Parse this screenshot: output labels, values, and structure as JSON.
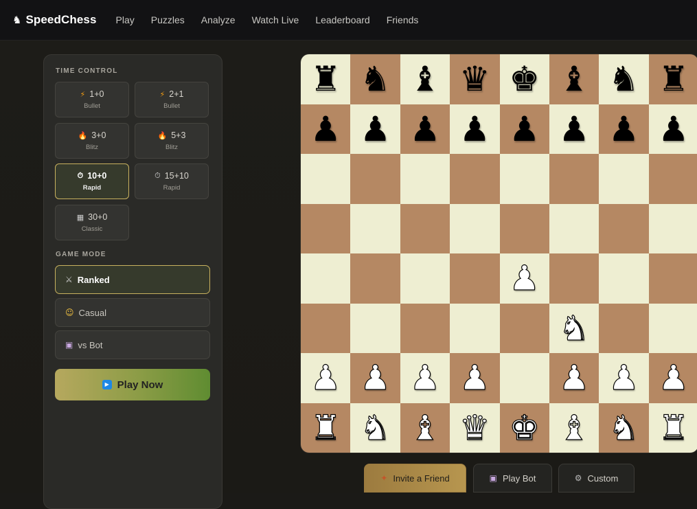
{
  "brand": {
    "icon": "knight-icon",
    "icon_glyph": "♞",
    "name": "SpeedChess"
  },
  "nav": [
    {
      "label": "Play"
    },
    {
      "label": "Puzzles"
    },
    {
      "label": "Analyze"
    },
    {
      "label": "Watch Live"
    },
    {
      "label": "Leaderboard"
    },
    {
      "label": "Friends"
    }
  ],
  "time_control": {
    "title": "TIME CONTROL",
    "options": [
      {
        "icon": "lightning-icon",
        "glyph": "⚡",
        "time": "1+0",
        "type": "Bullet",
        "selected": false
      },
      {
        "icon": "lightning-icon",
        "glyph": "⚡",
        "time": "2+1",
        "type": "Bullet",
        "selected": false
      },
      {
        "icon": "fire-icon",
        "glyph": "🔥",
        "time": "3+0",
        "type": "Blitz",
        "selected": false
      },
      {
        "icon": "fire-icon",
        "glyph": "🔥",
        "time": "5+3",
        "type": "Blitz",
        "selected": false
      },
      {
        "icon": "stopwatch-icon",
        "glyph": "⏱",
        "time": "10+0",
        "type": "Rapid",
        "selected": true
      },
      {
        "icon": "stopwatch-icon",
        "glyph": "⏱",
        "time": "15+10",
        "type": "Rapid",
        "selected": false
      },
      {
        "icon": "chequered-flag-icon",
        "glyph": "▦",
        "time": "30+0",
        "type": "Classic",
        "selected": false
      }
    ]
  },
  "game_mode": {
    "title": "GAME MODE",
    "options": [
      {
        "icon": "crossed-swords-icon",
        "glyph": "⚔",
        "label": "Ranked",
        "selected": true
      },
      {
        "icon": "smiley-icon",
        "glyph": "☺",
        "label": "Casual",
        "selected": false
      },
      {
        "icon": "robot-icon",
        "glyph": "▣",
        "label": "vs Bot",
        "selected": false
      }
    ]
  },
  "play_now": {
    "icon": "play-icon",
    "glyph": "▶",
    "label": "Play Now"
  },
  "board": {
    "light_color": "#eeeed2",
    "dark_color": "#b58863",
    "rows": [
      [
        "br",
        "bn",
        "bb",
        "bq",
        "bk",
        "bb",
        "bn",
        "br"
      ],
      [
        "bp",
        "bp",
        "bp",
        "bp",
        "bp",
        "bp",
        "bp",
        "bp"
      ],
      [
        "",
        "",
        "",
        "",
        "",
        "",
        "",
        ""
      ],
      [
        "",
        "",
        "",
        "",
        "",
        "",
        "",
        ""
      ],
      [
        "",
        "",
        "",
        "",
        "wp",
        "",
        "",
        ""
      ],
      [
        "",
        "",
        "",
        "",
        "",
        "wn",
        "",
        ""
      ],
      [
        "wp",
        "wp",
        "wp",
        "wp",
        "",
        "wp",
        "wp",
        "wp"
      ],
      [
        "wr",
        "wn",
        "wb",
        "wq",
        "wk",
        "wb",
        "wn",
        "wr"
      ]
    ]
  },
  "bottom_actions": [
    {
      "icon": "friend-icon",
      "glyph": "✦",
      "label": "Invite a Friend",
      "primary": true
    },
    {
      "icon": "robot-icon",
      "glyph": "▣",
      "label": "Play Bot",
      "primary": false
    },
    {
      "icon": "gear-icon",
      "glyph": "⚙",
      "label": "Custom",
      "primary": false
    }
  ]
}
